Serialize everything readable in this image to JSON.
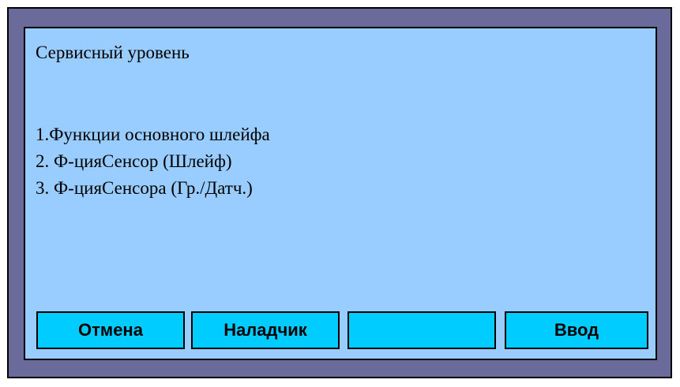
{
  "screen": {
    "title": "Сервисный уровень",
    "menu_items": [
      {
        "label": "1.Функции основного шлейфа"
      },
      {
        "label": "2. Ф-цияСенсор (Шлейф)"
      },
      {
        "label": "3. Ф-цияСенсора (Гр./Датч.)"
      }
    ]
  },
  "buttons": {
    "cancel_label": "Отмена",
    "adjuster_label": "Наладчик",
    "empty_label": "",
    "enter_label": "Ввод"
  },
  "colors": {
    "frame": "#6a6a9b",
    "screen_background": "#99ccff",
    "button_background": "#00ccff",
    "border": "#000000"
  }
}
